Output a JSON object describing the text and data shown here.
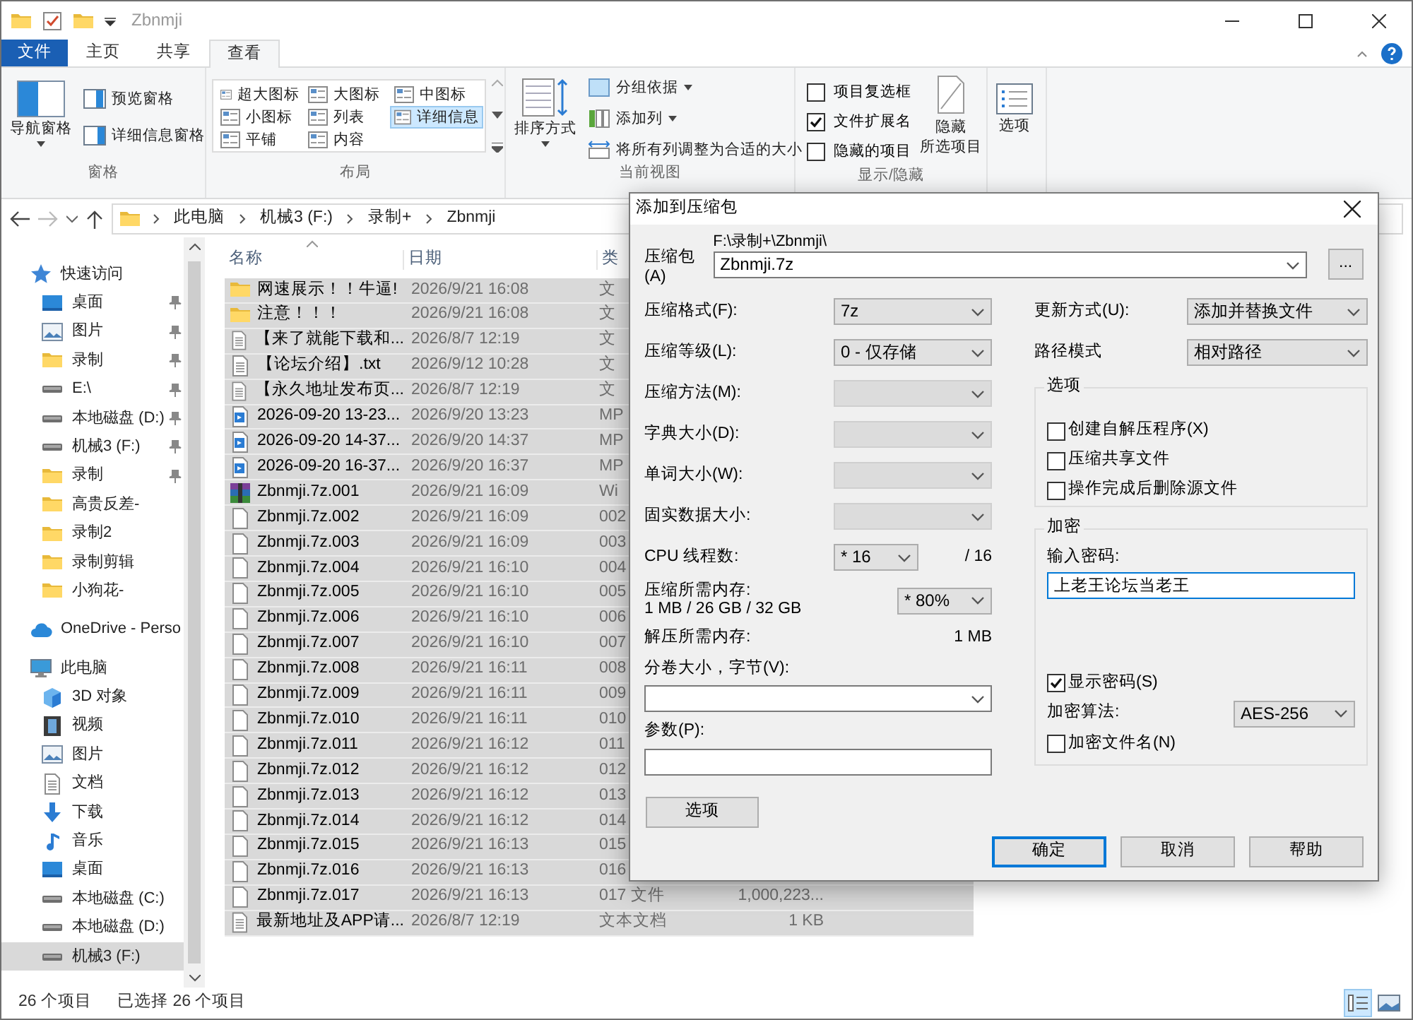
{
  "window": {
    "title": "Zbnmji"
  },
  "ribbon_tabs": [
    {
      "label": "文件",
      "kind": "file",
      "selected": false
    },
    {
      "label": "主页",
      "kind": "tab",
      "selected": false
    },
    {
      "label": "共享",
      "kind": "tab",
      "selected": false
    },
    {
      "label": "查看",
      "kind": "tab",
      "selected": true
    }
  ],
  "panes_group": {
    "title": "窗格",
    "navigation_pane": "导航窗格",
    "preview_pane": "预览窗格",
    "details_pane": "详细信息窗格"
  },
  "layout_group": {
    "title": "布局",
    "layouts": [
      {
        "label": "超大图标",
        "selected": false
      },
      {
        "label": "大图标",
        "selected": false
      },
      {
        "label": "中图标",
        "selected": false
      },
      {
        "label": "小图标",
        "selected": false
      },
      {
        "label": "列表",
        "selected": false
      },
      {
        "label": "详细信息",
        "selected": true
      },
      {
        "label": "平铺",
        "selected": false
      },
      {
        "label": "内容",
        "selected": false
      }
    ]
  },
  "current_view_group": {
    "title": "当前视图",
    "sort_by": "排序方式",
    "group_by": "分组依据",
    "add_columns": "添加列",
    "size_all_columns": "将所有列调整为合适的大小"
  },
  "show_hide_group": {
    "title": "显示/隐藏",
    "checkboxes": [
      {
        "label": "项目复选框",
        "checked": false
      },
      {
        "label": "文件扩展名",
        "checked": true
      },
      {
        "label": "隐藏的项目",
        "checked": false
      }
    ],
    "hide_selected": [
      "隐藏",
      "所选项目"
    ]
  },
  "options_button": "选项",
  "breadcrumbs": [
    "此电脑",
    "机械3 (F:)",
    "录制+",
    "Zbnmji"
  ],
  "nav_pane": [
    {
      "label": "快速访问",
      "kind": "star",
      "selected": false,
      "children": [
        {
          "label": "桌面",
          "kind": "desktop",
          "pinned": true,
          "selected": false
        },
        {
          "label": "图片",
          "kind": "pictures",
          "pinned": true,
          "selected": false
        },
        {
          "label": "录制",
          "kind": "folder",
          "pinned": true,
          "selected": false
        },
        {
          "label": "E:\\",
          "kind": "drive",
          "pinned": true,
          "selected": false
        },
        {
          "label": "本地磁盘 (D:)",
          "kind": "drive",
          "pinned": true,
          "selected": false
        },
        {
          "label": "机械3 (F:)",
          "kind": "drive",
          "pinned": true,
          "selected": false
        },
        {
          "label": "录制",
          "kind": "folder",
          "pinned": true,
          "selected": false
        },
        {
          "label": "高贵反差-",
          "kind": "folder",
          "pinned": false,
          "selected": false
        },
        {
          "label": "录制2",
          "kind": "folder",
          "pinned": false,
          "selected": false
        },
        {
          "label": "录制剪辑",
          "kind": "folder",
          "pinned": false,
          "selected": false
        },
        {
          "label": "小狗花-",
          "kind": "folder",
          "pinned": false,
          "selected": false
        }
      ]
    },
    {
      "label": "OneDrive - Perso",
      "kind": "cloud",
      "selected": false
    },
    {
      "label": "此电脑",
      "kind": "pc",
      "selected": false,
      "children": [
        {
          "label": "3D 对象",
          "kind": "cube",
          "selected": false
        },
        {
          "label": "视频",
          "kind": "film",
          "selected": false
        },
        {
          "label": "图片",
          "kind": "pictures",
          "selected": false
        },
        {
          "label": "文档",
          "kind": "text",
          "selected": false
        },
        {
          "label": "下载",
          "kind": "download",
          "selected": false
        },
        {
          "label": "音乐",
          "kind": "music",
          "selected": false
        },
        {
          "label": "桌面",
          "kind": "desktop",
          "selected": false
        },
        {
          "label": "本地磁盘 (C:)",
          "kind": "drive",
          "selected": false
        },
        {
          "label": "本地磁盘 (D:)",
          "kind": "drive",
          "selected": false
        },
        {
          "label": "机械3 (F:)",
          "kind": "drive",
          "selected": true
        }
      ]
    }
  ],
  "file_list": {
    "columns": [
      "名称",
      "日期",
      "类"
    ],
    "rows": [
      {
        "name": "网速展示！！牛逼!",
        "date": "2026/9/21 16:08",
        "type": "文",
        "kind": "folder",
        "selected": true
      },
      {
        "name": "注意！！！",
        "date": "2026/9/21 16:08",
        "type": "文",
        "kind": "folder",
        "selected": true
      },
      {
        "name": "【来了就能下载和...",
        "date": "2026/8/7 12:19",
        "type": "文",
        "kind": "text",
        "selected": true
      },
      {
        "name": "【论坛介绍】.txt",
        "date": "2026/9/12 10:28",
        "type": "文",
        "kind": "text",
        "selected": true
      },
      {
        "name": "【永久地址发布页...",
        "date": "2026/8/7 12:19",
        "type": "文",
        "kind": "text",
        "selected": true
      },
      {
        "name": "2026-09-20 13-23...",
        "date": "2026/9/20 13:23",
        "type": "MP",
        "kind": "video",
        "selected": true
      },
      {
        "name": "2026-09-20 14-37...",
        "date": "2026/9/20 14:37",
        "type": "MP",
        "kind": "video",
        "selected": true
      },
      {
        "name": "2026-09-20 16-37...",
        "date": "2026/9/20 16:37",
        "type": "MP",
        "kind": "video",
        "selected": true
      },
      {
        "name": "Zbnmji.7z.001",
        "date": "2026/9/21 16:09",
        "type": "Wi",
        "kind": "archive",
        "selected": true
      },
      {
        "name": "Zbnmji.7z.002",
        "date": "2026/9/21 16:09",
        "type": "002",
        "kind": "file",
        "selected": true
      },
      {
        "name": "Zbnmji.7z.003",
        "date": "2026/9/21 16:09",
        "type": "003",
        "kind": "file",
        "selected": true
      },
      {
        "name": "Zbnmji.7z.004",
        "date": "2026/9/21 16:10",
        "type": "004",
        "kind": "file",
        "selected": true
      },
      {
        "name": "Zbnmji.7z.005",
        "date": "2026/9/21 16:10",
        "type": "005",
        "kind": "file",
        "selected": true
      },
      {
        "name": "Zbnmji.7z.006",
        "date": "2026/9/21 16:10",
        "type": "006",
        "kind": "file",
        "selected": true
      },
      {
        "name": "Zbnmji.7z.007",
        "date": "2026/9/21 16:10",
        "type": "007",
        "kind": "file",
        "selected": true
      },
      {
        "name": "Zbnmji.7z.008",
        "date": "2026/9/21 16:11",
        "type": "008",
        "kind": "file",
        "selected": true
      },
      {
        "name": "Zbnmji.7z.009",
        "date": "2026/9/21 16:11",
        "type": "009",
        "kind": "file",
        "selected": true
      },
      {
        "name": "Zbnmji.7z.010",
        "date": "2026/9/21 16:11",
        "type": "010",
        "kind": "file",
        "selected": true
      },
      {
        "name": "Zbnmji.7z.011",
        "date": "2026/9/21 16:12",
        "type": "011",
        "kind": "file",
        "selected": true
      },
      {
        "name": "Zbnmji.7z.012",
        "date": "2026/9/21 16:12",
        "type": "012",
        "kind": "file",
        "selected": true
      },
      {
        "name": "Zbnmji.7z.013",
        "date": "2026/9/21 16:12",
        "type": "013",
        "kind": "file",
        "selected": true
      },
      {
        "name": "Zbnmji.7z.014",
        "date": "2026/9/21 16:12",
        "type": "014",
        "kind": "file",
        "selected": true
      },
      {
        "name": "Zbnmji.7z.015",
        "date": "2026/9/21 16:13",
        "type": "015",
        "kind": "file",
        "selected": true
      },
      {
        "name": "Zbnmji.7z.016",
        "date": "2026/9/21 16:13",
        "type": "016",
        "kind": "file",
        "selected": true
      },
      {
        "name": "Zbnmji.7z.017",
        "date": "2026/9/21 16:13",
        "type": "017 文件",
        "size": "1,000,223...",
        "kind": "file",
        "selected": true
      },
      {
        "name": "最新地址及APP请...",
        "date": "2026/8/7 12:19",
        "type": "文本文档",
        "size": "1 KB",
        "kind": "text",
        "selected": true
      }
    ]
  },
  "status_bar": {
    "item_count": "26 个项目",
    "selection": "已选择 26 个项目"
  },
  "view_toggles": [
    {
      "kind": "details",
      "selected": true
    },
    {
      "kind": "large-icons",
      "selected": false
    }
  ],
  "dialog": {
    "title": "添加到压缩包",
    "archive": {
      "label": "压缩包(A)",
      "path": "F:\\录制+\\Zbnmji\\",
      "value": "Zbnmji.7z",
      "browse": "..."
    },
    "left_fields": [
      {
        "label": "压缩格式(F):",
        "value": "7z",
        "disabled": false
      },
      {
        "label": "压缩等级(L):",
        "value": "0 - 仅存储",
        "disabled": false
      },
      {
        "label": "压缩方法(M):",
        "disabled": true
      },
      {
        "label": "字典大小(D):",
        "disabled": true
      },
      {
        "label": "单词大小(W):",
        "disabled": true
      },
      {
        "label": "固实数据大小:",
        "disabled": true
      }
    ],
    "cpu_threads": {
      "label": "CPU 线程数:",
      "value": "* 16",
      "max": "/ 16"
    },
    "memory": {
      "label": "压缩所需内存:",
      "detail": "1 MB / 26 GB / 32 GB",
      "value": "* 80%"
    },
    "decompress_memory": {
      "label": "解压所需内存:",
      "value": "1 MB"
    },
    "volume_size": {
      "label": "分卷大小，字节(V):"
    },
    "parameters": {
      "label": "参数(P):"
    },
    "options_button": "选项",
    "update_mode": {
      "label": "更新方式(U):",
      "value": "添加并替换文件"
    },
    "path_mode": {
      "label": "路径模式",
      "value": "相对路径"
    },
    "options_group": {
      "title": "选项",
      "checkboxes": [
        {
          "label": "创建自解压程序(X)",
          "checked": false
        },
        {
          "label": "压缩共享文件",
          "checked": false
        },
        {
          "label": "操作完成后删除源文件",
          "checked": false
        }
      ]
    },
    "encryption_group": {
      "title": "加密",
      "password_label": "输入密码:",
      "password": "上老王论坛当老王",
      "show_password": {
        "label": "显示密码(S)",
        "checked": true
      },
      "method_label": "加密算法:",
      "method": "AES-256",
      "encrypt_names": {
        "label": "加密文件名(N)",
        "checked": false
      }
    },
    "buttons": [
      {
        "label": "确定",
        "default": true
      },
      {
        "label": "取消",
        "default": false
      },
      {
        "label": "帮助",
        "default": false
      }
    ]
  }
}
